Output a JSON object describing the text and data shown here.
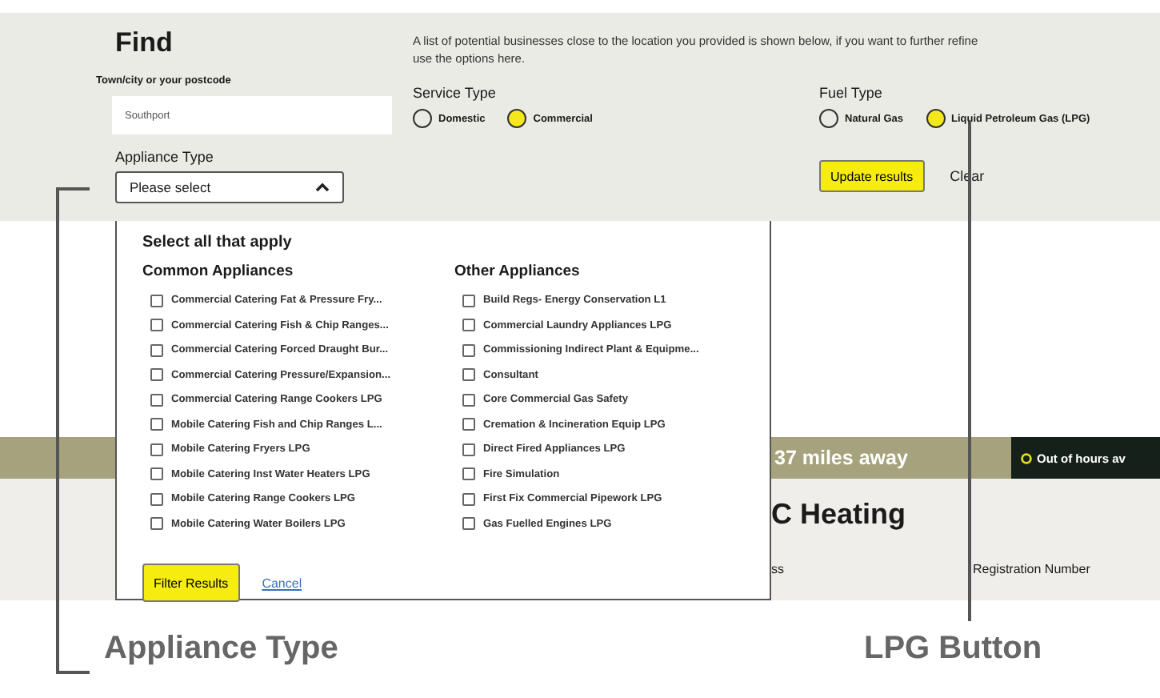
{
  "find": {
    "title": "Find",
    "description": [
      "A list of potential businesses close to the location you provided is shown below, if you want to further refine",
      "use the options here."
    ]
  },
  "location": {
    "label": "Town/city or your postcode",
    "value": "Southport"
  },
  "appliance_type": {
    "label": "Appliance Type",
    "placeholder": "Please select",
    "expanded": true
  },
  "service_type": {
    "label": "Service Type",
    "options": [
      {
        "label": "Domestic",
        "selected": false
      },
      {
        "label": "Commercial",
        "selected": true
      }
    ]
  },
  "fuel_type": {
    "label": "Fuel Type",
    "options": [
      {
        "label": "Natural Gas",
        "selected": false
      },
      {
        "label": "Liquid Petroleum Gas (LPG)",
        "selected": true
      }
    ]
  },
  "buttons": {
    "update": "Update results",
    "clear": "Clear"
  },
  "dropdown": {
    "heading": "Select all that apply",
    "groups": [
      {
        "title": "Common Appliances",
        "items": [
          {
            "label": "Commercial Catering Fat & Pressure Fry...",
            "checked": false
          },
          {
            "label": "Commercial Catering Fish & Chip Ranges...",
            "checked": false
          },
          {
            "label": "Commercial Catering Forced Draught Bur...",
            "checked": false
          },
          {
            "label": "Commercial Catering Pressure/Expansion...",
            "checked": false
          },
          {
            "label": "Commercial Catering Range Cookers LPG",
            "checked": false
          },
          {
            "label": "Mobile Catering Fish and Chip Ranges L...",
            "checked": false
          },
          {
            "label": "Mobile Catering Fryers LPG",
            "checked": false
          },
          {
            "label": "Mobile Catering Inst Water Heaters LPG",
            "checked": false
          },
          {
            "label": "Mobile Catering Range Cookers LPG",
            "checked": false
          },
          {
            "label": "Mobile Catering Water Boilers LPG",
            "checked": false
          }
        ]
      },
      {
        "title": "Other Appliances",
        "items": [
          {
            "label": "Build Regs- Energy Conservation L1",
            "checked": false
          },
          {
            "label": "Commercial Laundry Appliances LPG",
            "checked": false
          },
          {
            "label": "Commissioning Indirect Plant & Equipme...",
            "checked": false
          },
          {
            "label": "Consultant",
            "checked": false
          },
          {
            "label": "Core Commercial Gas Safety",
            "checked": false
          },
          {
            "label": "Cremation & Incineration Equip LPG",
            "checked": false
          },
          {
            "label": "Direct Fired Appliances LPG",
            "checked": false
          },
          {
            "label": "Fire Simulation",
            "checked": false
          },
          {
            "label": "First Fix Commercial Pipework LPG",
            "checked": false
          },
          {
            "label": "Gas Fuelled Engines LPG",
            "checked": false
          }
        ]
      }
    ],
    "filter": "Filter Results",
    "cancel": "Cancel"
  },
  "result": {
    "distance": "37 miles away",
    "badge": "Out of hours av",
    "name": "C Heating",
    "fields": [
      "ss",
      "Registration Number"
    ]
  },
  "annotations": [
    "Appliance Type",
    "LPG Button"
  ]
}
